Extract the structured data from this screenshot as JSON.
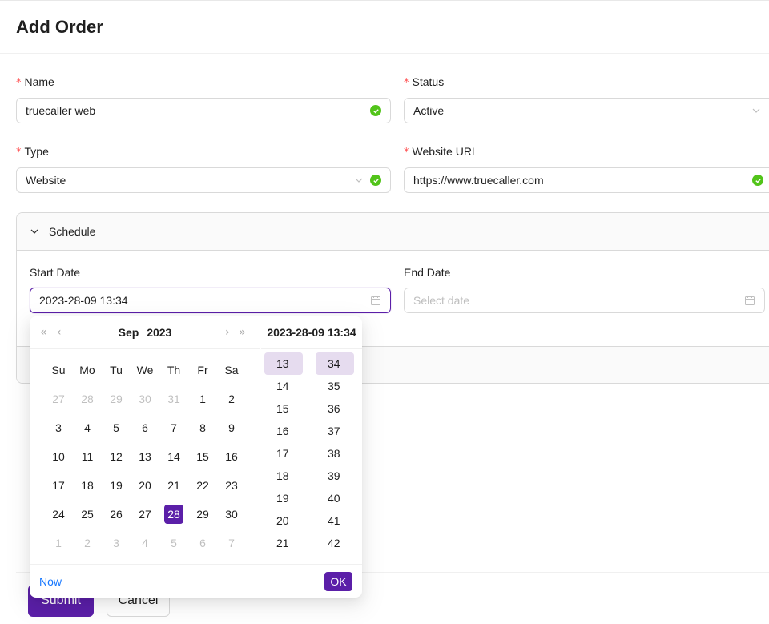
{
  "page": {
    "title": "Add Order"
  },
  "form": {
    "name": {
      "label": "Name",
      "value": "truecaller web"
    },
    "status": {
      "label": "Status",
      "value": "Active"
    },
    "type": {
      "label": "Type",
      "value": "Website"
    },
    "website_url": {
      "label": "Website URL",
      "value": "https://www.truecaller.com"
    },
    "schedule": {
      "title": "Schedule",
      "start_date": {
        "label": "Start Date",
        "value": "2023-28-09 13:34"
      },
      "end_date": {
        "label": "End Date",
        "placeholder": "Select date"
      }
    },
    "submit_label": "Submit",
    "cancel_label": "Cancel"
  },
  "datepicker": {
    "month": "Sep",
    "year": "2023",
    "time_header": "2023-28-09 13:34",
    "weekdays": [
      "Su",
      "Mo",
      "Tu",
      "We",
      "Th",
      "Fr",
      "Sa"
    ],
    "weeks": [
      [
        {
          "d": "27",
          "out": true
        },
        {
          "d": "28",
          "out": true
        },
        {
          "d": "29",
          "out": true
        },
        {
          "d": "30",
          "out": true
        },
        {
          "d": "31",
          "out": true
        },
        {
          "d": "1"
        },
        {
          "d": "2"
        }
      ],
      [
        {
          "d": "3"
        },
        {
          "d": "4"
        },
        {
          "d": "5"
        },
        {
          "d": "6"
        },
        {
          "d": "7"
        },
        {
          "d": "8"
        },
        {
          "d": "9"
        }
      ],
      [
        {
          "d": "10"
        },
        {
          "d": "11"
        },
        {
          "d": "12"
        },
        {
          "d": "13"
        },
        {
          "d": "14"
        },
        {
          "d": "15"
        },
        {
          "d": "16"
        }
      ],
      [
        {
          "d": "17"
        },
        {
          "d": "18"
        },
        {
          "d": "19"
        },
        {
          "d": "20"
        },
        {
          "d": "21"
        },
        {
          "d": "22"
        },
        {
          "d": "23"
        }
      ],
      [
        {
          "d": "24"
        },
        {
          "d": "25"
        },
        {
          "d": "26"
        },
        {
          "d": "27"
        },
        {
          "d": "28",
          "selected": true
        },
        {
          "d": "29"
        },
        {
          "d": "30"
        }
      ],
      [
        {
          "d": "1",
          "out": true
        },
        {
          "d": "2",
          "out": true
        },
        {
          "d": "3",
          "out": true
        },
        {
          "d": "4",
          "out": true
        },
        {
          "d": "5",
          "out": true
        },
        {
          "d": "6",
          "out": true
        },
        {
          "d": "7",
          "out": true
        }
      ]
    ],
    "hours": [
      "13",
      "14",
      "15",
      "16",
      "17",
      "18",
      "19",
      "20",
      "21"
    ],
    "selected_hour": "13",
    "minutes": [
      "34",
      "35",
      "36",
      "37",
      "38",
      "39",
      "40",
      "41",
      "42"
    ],
    "selected_minute": "34",
    "now_label": "Now",
    "ok_label": "OK"
  },
  "colors": {
    "primary": "#5b1fa8",
    "success": "#52c41a",
    "required": "#ff4d4f",
    "link": "#1677ff"
  },
  "icons": {
    "valid": "check-circle-icon",
    "dropdown": "chevron-down-icon",
    "calendar": "calendar-icon",
    "collapse": "chevron-down-icon"
  }
}
